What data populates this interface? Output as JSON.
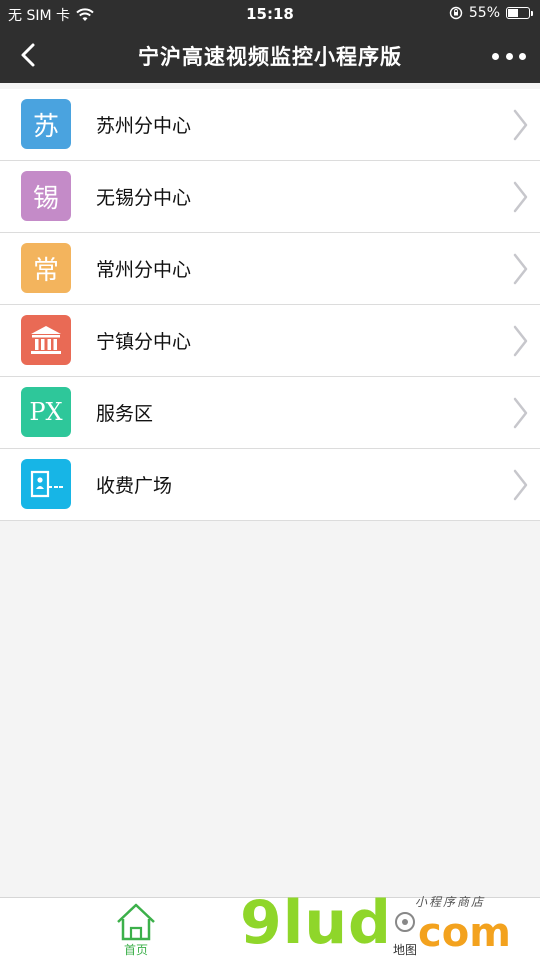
{
  "status_bar": {
    "carrier": "无 SIM 卡",
    "time": "15:18",
    "battery_percent": "55%",
    "battery_level": 0.55
  },
  "nav": {
    "title": "宁沪高速视频监控小程序版"
  },
  "list": {
    "items": [
      {
        "label": "苏州分中心",
        "icon": "su-character-icon",
        "icon_glyph": "苏",
        "color": "#4aa3df"
      },
      {
        "label": "无锡分中心",
        "icon": "xi-character-icon",
        "icon_glyph": "锡",
        "color": "#c48bc8"
      },
      {
        "label": "常州分中心",
        "icon": "chang-character-icon",
        "icon_glyph": "常",
        "color": "#f3b45d"
      },
      {
        "label": "宁镇分中心",
        "icon": "bank-building-icon",
        "icon_glyph": "",
        "color": "#e96a55"
      },
      {
        "label": "服务区",
        "icon": "service-area-icon",
        "icon_glyph": "PX",
        "color": "#2ec79a"
      },
      {
        "label": "收费广场",
        "icon": "toll-plaza-icon",
        "icon_glyph": "",
        "color": "#17b5e6"
      }
    ]
  },
  "tabbar": {
    "home_label": "首页",
    "map_label": "地图",
    "active_color": "#3cb04a"
  },
  "watermark": {
    "main": "9lud",
    "com": "com",
    "small": "小程序商店"
  }
}
